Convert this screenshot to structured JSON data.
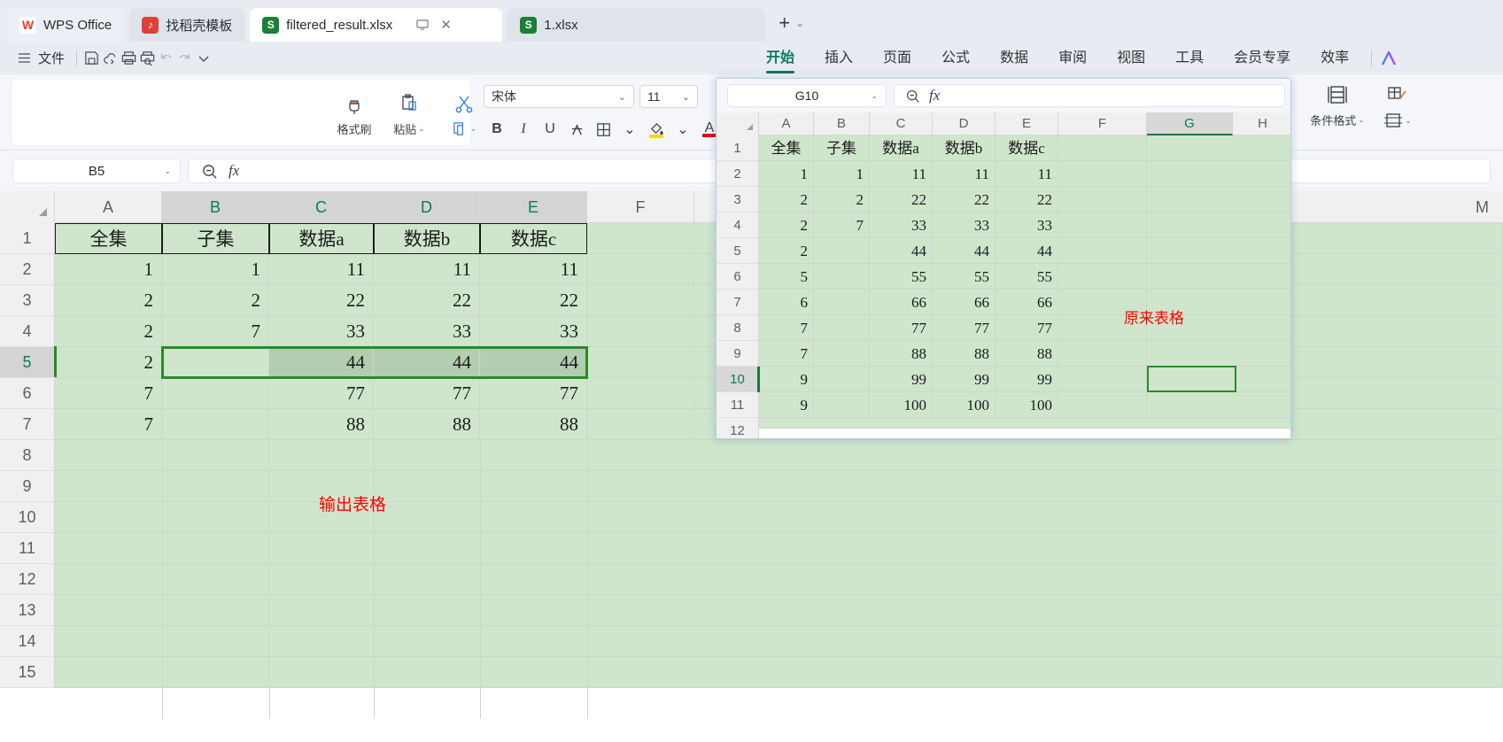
{
  "window": {
    "tabs": [
      {
        "label": "WPS Office",
        "icon": "wps-logo",
        "active": false
      },
      {
        "label": "找稻壳模板",
        "icon": "docer-icon",
        "active": false
      },
      {
        "label": "filtered_result.xlsx",
        "icon": "spreadsheet-icon",
        "active": true
      },
      {
        "label": "1.xlsx",
        "icon": "spreadsheet-icon",
        "active": false
      }
    ],
    "new_tab_label": "+",
    "new_tab_caret": "⌄"
  },
  "quickbar": {
    "menu_label": "文件",
    "icons": [
      "hamburger-icon",
      "save-icon",
      "cloud-sync-icon",
      "print-icon",
      "print-preview-icon",
      "undo-icon",
      "redo-icon",
      "more-caret-icon"
    ]
  },
  "menus": [
    {
      "label": "开始",
      "active": true
    },
    {
      "label": "插入",
      "active": false
    },
    {
      "label": "页面",
      "active": false
    },
    {
      "label": "公式",
      "active": false
    },
    {
      "label": "数据",
      "active": false
    },
    {
      "label": "审阅",
      "active": false
    },
    {
      "label": "视图",
      "active": false
    },
    {
      "label": "工具",
      "active": false
    },
    {
      "label": "会员专享",
      "active": false
    },
    {
      "label": "效率",
      "active": false
    }
  ],
  "ribbon": {
    "format_painter": "格式刷",
    "paste": "粘贴",
    "copy": "",
    "cut": "",
    "font_name": "宋体",
    "font_size": "11",
    "bold": "B",
    "italic": "I",
    "underline": "U",
    "strike": "A",
    "borders": "",
    "fill_color": "",
    "font_color": "A",
    "fill_swatch": "#ffd700",
    "font_swatch": "#e80000",
    "conditional_format": "条件格式",
    "caret": "⌄"
  },
  "main_sheet": {
    "name_box": "B5",
    "formula_value": "",
    "columns": [
      "A",
      "B",
      "C",
      "D",
      "E",
      "F",
      "M"
    ],
    "selected_columns": [
      "B",
      "C",
      "D",
      "E"
    ],
    "rows": [
      "1",
      "2",
      "3",
      "4",
      "5",
      "6",
      "7",
      "8",
      "9",
      "10",
      "11",
      "12",
      "13",
      "14",
      "15"
    ],
    "selected_row": "5",
    "headers": [
      "全集",
      "子集",
      "数据a",
      "数据b",
      "数据c"
    ],
    "data": [
      [
        "1",
        "1",
        "11",
        "11",
        "11"
      ],
      [
        "2",
        "2",
        "22",
        "22",
        "22"
      ],
      [
        "2",
        "7",
        "33",
        "33",
        "33"
      ],
      [
        "2",
        "",
        "44",
        "44",
        "44"
      ],
      [
        "7",
        "",
        "77",
        "77",
        "77"
      ],
      [
        "7",
        "",
        "88",
        "88",
        "88"
      ]
    ],
    "annotation": "输出表格",
    "annotation_color": "#ff0000",
    "selection_range": "B5:E5"
  },
  "overlay_sheet": {
    "name_box": "G10",
    "formula_value": "",
    "columns": [
      "A",
      "B",
      "C",
      "D",
      "E",
      "F",
      "G",
      "H"
    ],
    "selected_column": "G",
    "rows": [
      "1",
      "2",
      "3",
      "4",
      "5",
      "6",
      "7",
      "8",
      "9",
      "10",
      "11",
      "12"
    ],
    "selected_row": "10",
    "headers": [
      "全集",
      "子集",
      "数据a",
      "数据b",
      "数据c"
    ],
    "data": [
      [
        "1",
        "1",
        "11",
        "11",
        "11"
      ],
      [
        "2",
        "2",
        "22",
        "22",
        "22"
      ],
      [
        "2",
        "7",
        "33",
        "33",
        "33"
      ],
      [
        "2",
        "",
        "44",
        "44",
        "44"
      ],
      [
        "5",
        "",
        "55",
        "55",
        "55"
      ],
      [
        "6",
        "",
        "66",
        "66",
        "66"
      ],
      [
        "7",
        "",
        "77",
        "77",
        "77"
      ],
      [
        "7",
        "",
        "88",
        "88",
        "88"
      ],
      [
        "9",
        "",
        "99",
        "99",
        "99"
      ],
      [
        "9",
        "",
        "100",
        "100",
        "100"
      ]
    ],
    "annotation": "原来表格",
    "annotation_color": "#ff0000",
    "selection_range": "G10"
  },
  "colors": {
    "accent": "#0a7a5a",
    "grid_fill": "#cfe6cd",
    "selection_border": "#2a8a2a",
    "selection_fill": "#b3cdb1",
    "tabbar_bg": "#e8ebf2"
  }
}
